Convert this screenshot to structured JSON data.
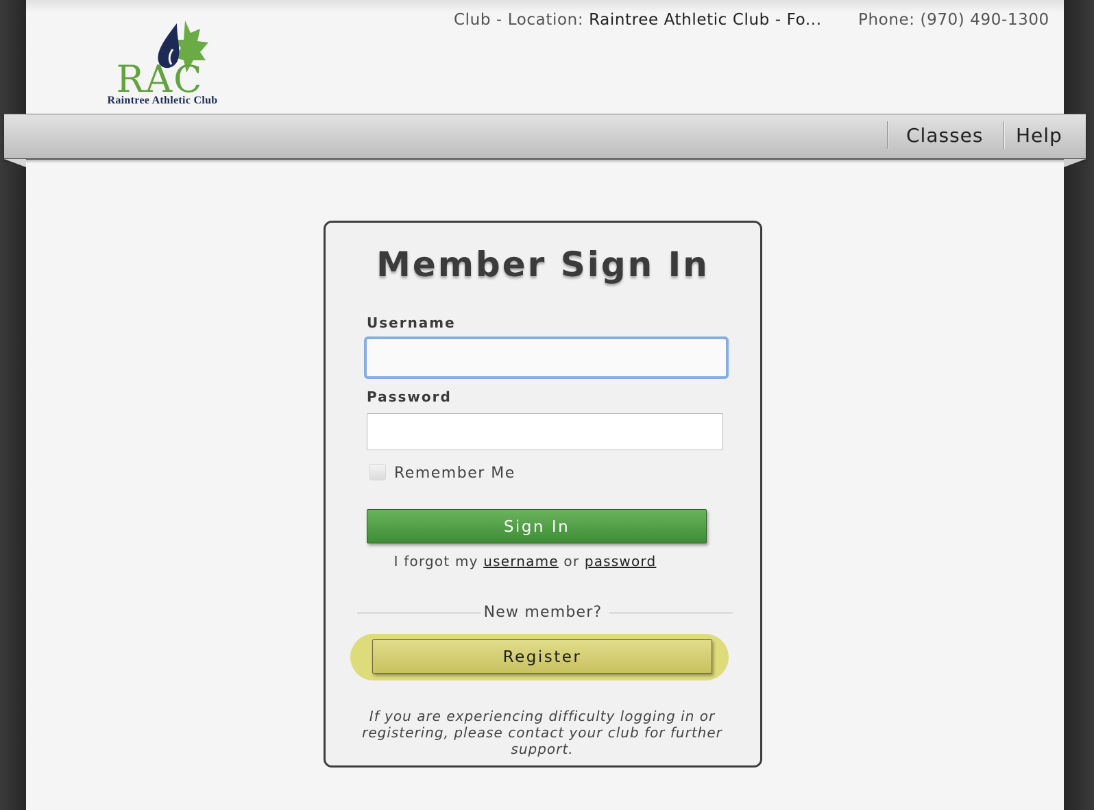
{
  "header": {
    "logo_letters": "RAC",
    "logo_subtitle": "Raintree Athletic Club",
    "club_label": "Club - Location: ",
    "club_value": "Raintree Athletic Club - Fo...",
    "phone": "Phone: (970) 490-1300"
  },
  "nav": {
    "items": [
      {
        "label": "Classes"
      },
      {
        "label": "Help"
      }
    ]
  },
  "signin": {
    "title": "Member Sign In",
    "username_label": "Username",
    "username_value": "",
    "password_label": "Password",
    "password_value": "",
    "remember_label": "Remember Me",
    "remember_checked": false,
    "submit_label": "Sign In",
    "forgot_prefix": "I forgot my ",
    "forgot_username": "username",
    "forgot_or": " or ",
    "forgot_password": "password",
    "new_member": "New member?",
    "register_label": "Register",
    "help_note": "If you are experiencing difficulty logging in or registering, please contact your club for further support."
  },
  "colors": {
    "brand_green": "#62a340",
    "brand_navy": "#1c2a55",
    "signin_button": "#4e9e45",
    "register_button": "#d6d173",
    "register_highlight": "#dedc7a",
    "focus_ring": "#85aee8"
  }
}
